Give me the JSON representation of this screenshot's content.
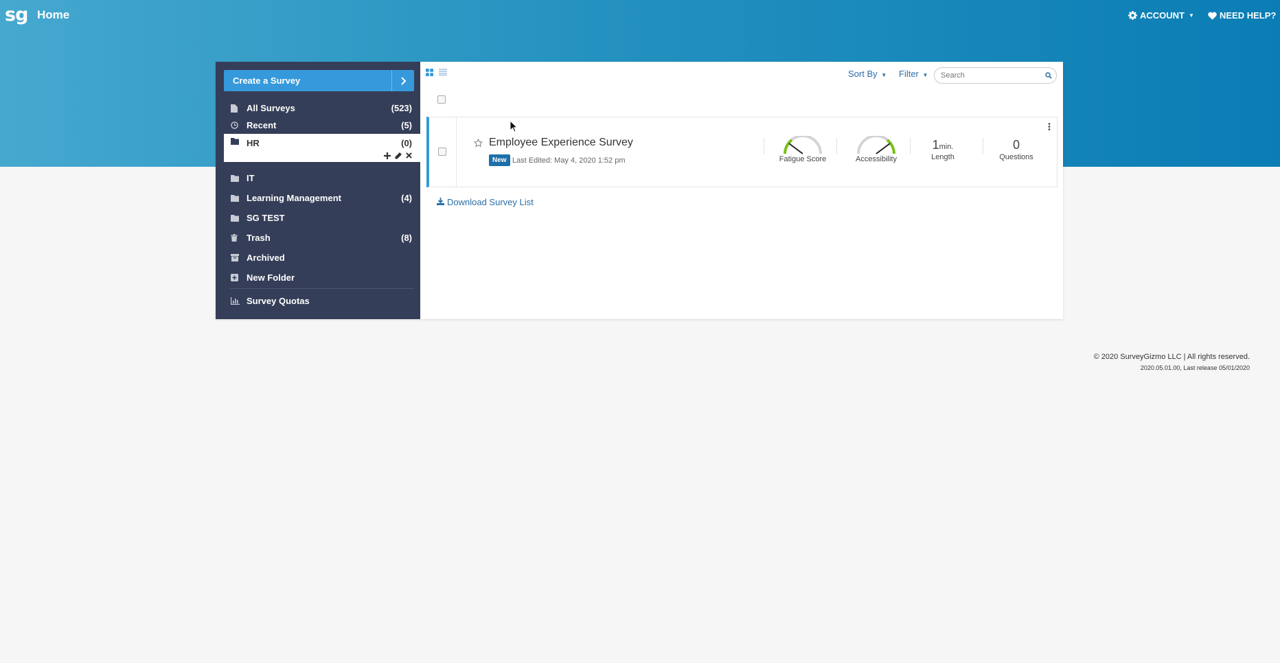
{
  "topbar": {
    "logo": "sg",
    "title": "Home",
    "account_label": "ACCOUNT",
    "help_label": "NEED HELP?"
  },
  "sidebar": {
    "create_label": "Create a Survey",
    "folders": [
      {
        "icon": "file-icon",
        "label": "All Surveys",
        "count": "(523)"
      },
      {
        "icon": "clock-icon",
        "label": "Recent",
        "count": "(5)"
      },
      {
        "icon": "folder-icon",
        "label": "HR",
        "count": "(0)",
        "active": true
      },
      {
        "icon": "folder-icon",
        "label": "IT",
        "count": ""
      },
      {
        "icon": "folder-icon",
        "label": "Learning Management",
        "count": "(4)"
      },
      {
        "icon": "folder-icon",
        "label": "SG TEST",
        "count": ""
      },
      {
        "icon": "trash-icon",
        "label": "Trash",
        "count": "(8)"
      },
      {
        "icon": "archive-icon",
        "label": "Archived",
        "count": ""
      },
      {
        "icon": "plus-square-icon",
        "label": "New Folder",
        "count": ""
      },
      {
        "icon": "bar-chart-icon",
        "label": "Survey Quotas",
        "count": ""
      }
    ]
  },
  "toolbar": {
    "sort_label": "Sort By",
    "filter_label": "Filter",
    "search_placeholder": "Search"
  },
  "survey": {
    "title": "Employee Experience Survey",
    "badge": "New",
    "last_edited": "Last Edited: May 4, 2020 1:52 pm",
    "fatigue_label": "Fatigue Score",
    "accessibility_label": "Accessibility",
    "length_value": "1",
    "length_unit": "min.",
    "length_label": "Length",
    "questions_value": "0",
    "questions_label": "Questions"
  },
  "download_label": "Download Survey List",
  "footer": {
    "copyright": "© 2020 SurveyGizmo LLC | All rights reserved.",
    "release": "2020.05.01.00, Last release 05/01/2020"
  },
  "colors": {
    "sidebar_bg": "#353e58",
    "accent": "#3599db",
    "link": "#2a6fa8",
    "badge": "#1c6fa9"
  }
}
